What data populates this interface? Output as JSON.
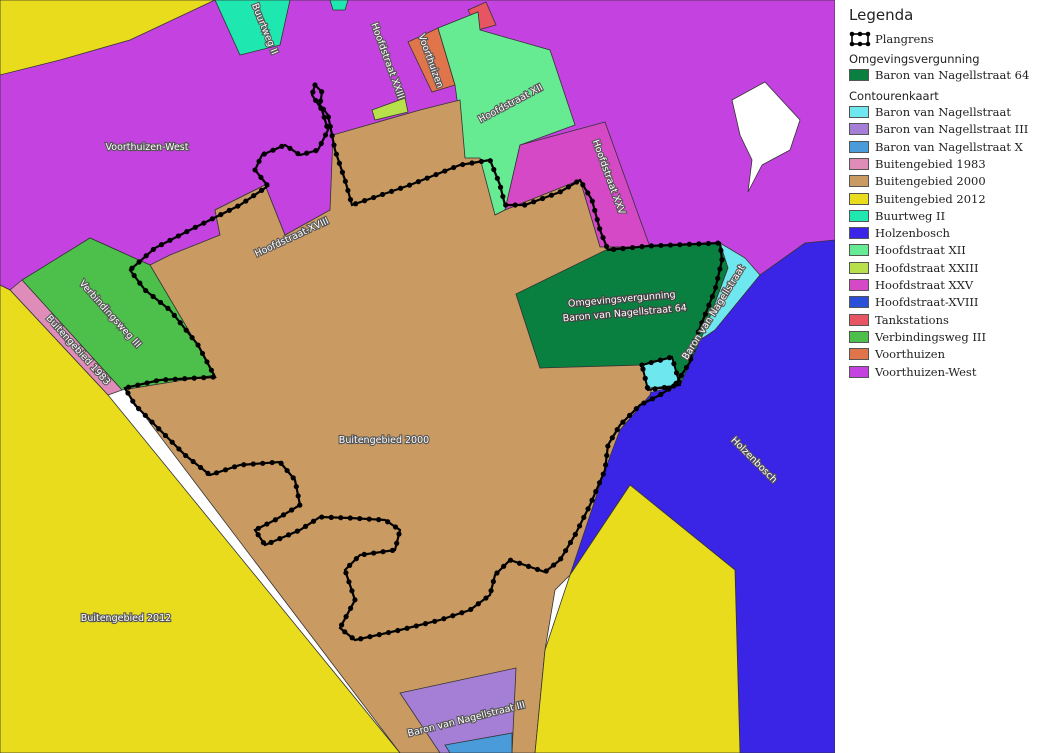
{
  "legend": {
    "title": "Legenda",
    "plangrens": "Plangrens",
    "group_omgevingsvergunning": "Omgevingsvergunning",
    "omgevingsvergunning_items": [
      {
        "label": "Baron van Nagellstraat 64",
        "color": "#0a8040"
      }
    ],
    "group_contourenkaart": "Contourenkaart",
    "contourenkaart_items": [
      {
        "label": "Baron van Nagellstraat",
        "color": "#6ee8ee"
      },
      {
        "label": "Baron van Nagellstraat III",
        "color": "#a57ed6"
      },
      {
        "label": "Baron van Nagellstraat X",
        "color": "#4a9bd9"
      },
      {
        "label": "Buitengebied 1983",
        "color": "#e08cb8"
      },
      {
        "label": "Buitengebied 2000",
        "color": "#c99a62"
      },
      {
        "label": "Buitengebied 2012",
        "color": "#e8dc1c"
      },
      {
        "label": "Buurtweg II",
        "color": "#1ee8b0"
      },
      {
        "label": "Holzenbosch",
        "color": "#3a24e6"
      },
      {
        "label": "Hoofdstraat XII",
        "color": "#66ea92"
      },
      {
        "label": "Hoofdstraat XXIII",
        "color": "#b7e04a"
      },
      {
        "label": "Hoofdstraat XXV",
        "color": "#d548c6"
      },
      {
        "label": "Hoofdstraat-XVIII",
        "color": "#2a50d8"
      },
      {
        "label": "Tankstations",
        "color": "#e85562"
      },
      {
        "label": "Verbindingsweg III",
        "color": "#4cc04a"
      },
      {
        "label": "Voorthuizen",
        "color": "#e0744a"
      },
      {
        "label": "Voorthuizen-West",
        "color": "#c443e0"
      }
    ]
  },
  "map_labels": {
    "voorthuizen_west": "Voorthuizen-West",
    "buurtweg_ii": "Buurtweg II",
    "hoofdstraat_xxiii": "Hoofdstraat XXIII",
    "voorthuizen": "Voorthuizen",
    "hoofdstraat_xii": "Hoofdstraat XII",
    "hoofdstraat_xxv": "Hoofdstraat XXV",
    "hoofdstraat_xviii": "Hoofdstraat-XVIII",
    "verbindingsweg_iii": "Verbindingsweg III",
    "buitengebied_1983": "Buitengebied 1983",
    "buitengebied_2000": "Buitengebied 2000",
    "buitengebied_2012": "Buitengebied 2012",
    "omgevingsvergunning_1": "Omgevingsvergunning",
    "omgevingsvergunning_2": "Baron van Nagellstraat 64",
    "baron_van_nagellstraat": "Baron van Nagellstraat",
    "holzenbosch": "Holzenbosch",
    "baron_van_nagellstraat_iii": "Baron van Nagellstraat III"
  }
}
